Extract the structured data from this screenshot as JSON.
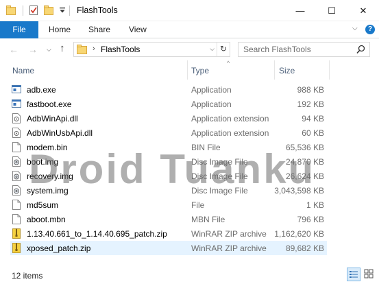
{
  "window": {
    "title": "FlashTools",
    "minimize_glyph": "—",
    "maximize_glyph": "☐",
    "close_glyph": "✕"
  },
  "ribbon": {
    "tabs": [
      "File",
      "Home",
      "Share",
      "View"
    ],
    "collapse_glyph": "⌵",
    "help_glyph": "?"
  },
  "nav": {
    "back_glyph": "←",
    "forward_glyph": "→",
    "recent_glyph": "⌵",
    "up_glyph": "↑",
    "breadcrumb_sep": "›",
    "path": "FlashTools",
    "dropdown_glyph": "⌵",
    "refresh_glyph": "↻",
    "search_placeholder": "Search FlashTools"
  },
  "columns": {
    "name": "Name",
    "type": "Type",
    "size": "Size",
    "sort_glyph": "^"
  },
  "files": [
    {
      "name": "adb.exe",
      "type": "Application",
      "size": "988 KB",
      "icon": "app-icon"
    },
    {
      "name": "fastboot.exe",
      "type": "Application",
      "size": "192 KB",
      "icon": "app-icon"
    },
    {
      "name": "AdbWinApi.dll",
      "type": "Application extension",
      "size": "94 KB",
      "icon": "dll-icon"
    },
    {
      "name": "AdbWinUsbApi.dll",
      "type": "Application extension",
      "size": "60 KB",
      "icon": "dll-icon"
    },
    {
      "name": "modem.bin",
      "type": "BIN File",
      "size": "65,536 KB",
      "icon": "file-icon"
    },
    {
      "name": "boot.img",
      "type": "Disc Image File",
      "size": "24,870 KB",
      "icon": "disc-image-icon"
    },
    {
      "name": "recovery.img",
      "type": "Disc Image File",
      "size": "26,624 KB",
      "icon": "disc-image-icon"
    },
    {
      "name": "system.img",
      "type": "Disc Image File",
      "size": "3,043,598 KB",
      "icon": "disc-image-icon"
    },
    {
      "name": "md5sum",
      "type": "File",
      "size": "1 KB",
      "icon": "file-icon"
    },
    {
      "name": "aboot.mbn",
      "type": "MBN File",
      "size": "796 KB",
      "icon": "file-icon"
    },
    {
      "name": "1.13.40.661_to_1.14.40.695_patch.zip",
      "type": "WinRAR ZIP archive",
      "size": "1,162,620 KB",
      "icon": "zip-icon"
    },
    {
      "name": "xposed_patch.zip",
      "type": "WinRAR ZIP archive",
      "size": "89,682 KB",
      "icon": "zip-icon",
      "selected": true
    }
  ],
  "status": {
    "item_count": "12 items"
  },
  "watermark": "Droid Tuanku",
  "colors": {
    "accent": "#1979ca",
    "selection": "#e5f3ff",
    "header_text": "#4c607a",
    "secondary_text": "#6d6d6d"
  }
}
